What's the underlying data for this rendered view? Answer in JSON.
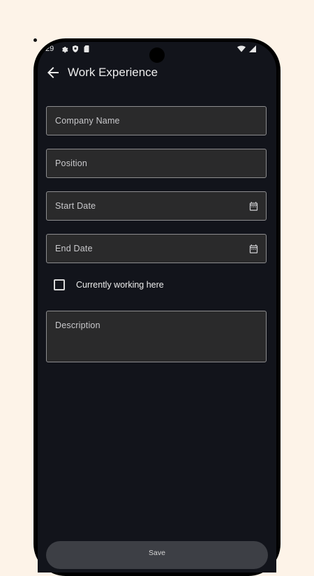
{
  "status_bar": {
    "time": ":29",
    "icons": [
      "gear-icon",
      "shield-icon",
      "sim-card-icon",
      "wifi-icon",
      "signal-icon"
    ]
  },
  "app_bar": {
    "back_icon": "arrow-back-icon",
    "title": "Work Experience"
  },
  "form": {
    "company_name": {
      "placeholder": "Company Name",
      "value": ""
    },
    "position": {
      "placeholder": "Position",
      "value": ""
    },
    "start_date": {
      "placeholder": "Start Date",
      "value": "",
      "icon": "calendar-icon"
    },
    "end_date": {
      "placeholder": "End Date",
      "value": "",
      "icon": "calendar-icon"
    },
    "currently_working": {
      "label": "Currently working here",
      "checked": false
    },
    "description": {
      "placeholder": "Description",
      "value": ""
    }
  },
  "actions": {
    "save_label": "Save"
  },
  "colors": {
    "page_background": "#fdf3e8",
    "screen_background": "#12141b",
    "field_background": "#2a2a2b",
    "field_border": "#8d8d8f",
    "button_background": "#3d3f45",
    "text_primary": "#ececec"
  }
}
